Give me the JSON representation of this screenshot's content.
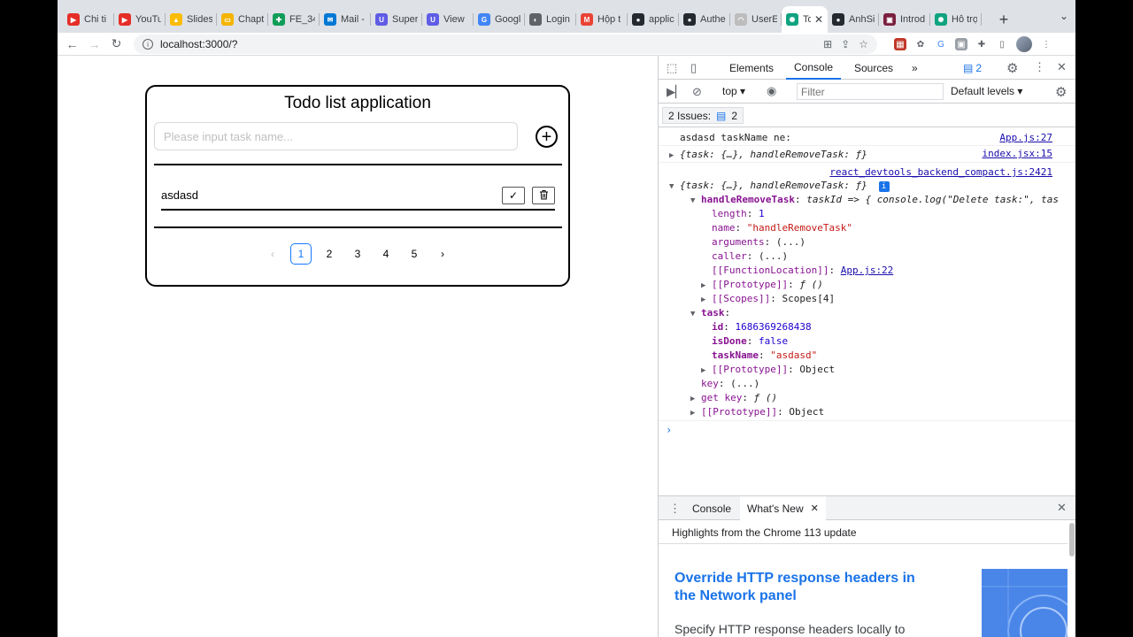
{
  "browser": {
    "tabs": [
      {
        "label": "Chi ti",
        "color": "#e52d27",
        "glyph": "▶"
      },
      {
        "label": "YouTu",
        "color": "#e52d27",
        "glyph": "▶"
      },
      {
        "label": "Slides",
        "color": "#fbbc04",
        "glyph": "▲"
      },
      {
        "label": "Chapt",
        "color": "#f4b400",
        "glyph": "▭"
      },
      {
        "label": "FE_34",
        "color": "#0f9d58",
        "glyph": "✚"
      },
      {
        "label": "Mail -",
        "color": "#0078d4",
        "glyph": "✉"
      },
      {
        "label": "Super",
        "color": "#5f5ce6",
        "glyph": "U"
      },
      {
        "label": "View",
        "color": "#5f5ce6",
        "glyph": "U"
      },
      {
        "label": "Googl",
        "color": "#4285f4",
        "glyph": "G"
      },
      {
        "label": "Login",
        "color": "#5f6368",
        "glyph": "◐"
      },
      {
        "label": "Hộp t",
        "color": "#ea4335",
        "glyph": "M"
      },
      {
        "label": "applic",
        "color": "#24292f",
        "glyph": "●"
      },
      {
        "label": "Authe",
        "color": "#24292f",
        "glyph": "●"
      },
      {
        "label": "UserE",
        "color": "#bdbdbd",
        "glyph": "◠"
      },
      {
        "label": "To",
        "color": "#10a37f",
        "glyph": "✺",
        "active": true
      },
      {
        "label": "AnhSi",
        "color": "#24292f",
        "glyph": "●"
      },
      {
        "label": "Introd",
        "color": "#7a1f3d",
        "glyph": "▣"
      },
      {
        "label": "Hỗ trợ",
        "color": "#10a37f",
        "glyph": "✺"
      }
    ],
    "new_tab_glyph": "+",
    "tab_menu_glyph": "⌄",
    "url": "localhost:3000/?"
  },
  "todo": {
    "title": "Todo list application",
    "input_placeholder": "Please input task name...",
    "input_value": "",
    "add_glyph": "+",
    "tasks": [
      {
        "name": "asdasd",
        "done_glyph": "✓",
        "delete_glyph": "🗑"
      }
    ],
    "pagination": {
      "prev": "‹",
      "pages": [
        "1",
        "2",
        "3",
        "4",
        "5"
      ],
      "current": "1",
      "next": "›"
    }
  },
  "devtools": {
    "tabs": [
      "Elements",
      "Console",
      "Sources"
    ],
    "active_tab": "Console",
    "more_tabs": "»",
    "issue_badge": "2",
    "context": "top",
    "filter_placeholder": "Filter",
    "levels": "Default levels ▾",
    "issues_label": "2 Issues:",
    "issues_count": "2",
    "console": {
      "log1_text": "asdasd taskName ne:",
      "log1_src": "App.js:27",
      "log2_text": "{task: {…}, handleRemoveTask: ƒ}",
      "log2_src": "index.jsx:15",
      "log3_src": "react_devtools_backend_compact.js:2421",
      "log3_text": "{task: {…}, handleRemoveTask: ƒ}",
      "info_badge": "i",
      "fn_key": "handleRemoveTask",
      "fn_value": "taskId => { console.log(\"Delete task:\", tas",
      "length_key": "length",
      "length_value": "1",
      "name_key": "name",
      "name_value": "\"handleRemoveTask\"",
      "arguments_key": "arguments",
      "arguments_value": "(...)",
      "caller_key": "caller",
      "caller_value": "(...)",
      "fnloc_key": "[[FunctionLocation]]",
      "fnloc_value": "App.js:22",
      "proto1_key": "[[Prototype]]",
      "proto1_value": "ƒ ()",
      "scopes_key": "[[Scopes]]",
      "scopes_value": "Scopes[4]",
      "task_key": "task",
      "id_key": "id",
      "id_value": "1686369268438",
      "isdone_key": "isDone",
      "isdone_value": "false",
      "taskname_key": "taskName",
      "taskname_value": "\"asdasd\"",
      "proto2_key": "[[Prototype]]",
      "proto2_value": "Object",
      "key_key": "key",
      "key_value": "(...)",
      "getkey_key": "get key",
      "getkey_value": "ƒ ()",
      "proto3_key": "[[Prototype]]",
      "proto3_value": "Object",
      "prompt": "›"
    },
    "drawer": {
      "tabs": [
        "Console",
        "What's New"
      ],
      "active_tab": "What's New",
      "highlights": "Highlights from the Chrome 113 update",
      "feature_title": "Override HTTP response headers in the Network panel",
      "feature_desc": "Specify HTTP response headers locally to"
    }
  }
}
